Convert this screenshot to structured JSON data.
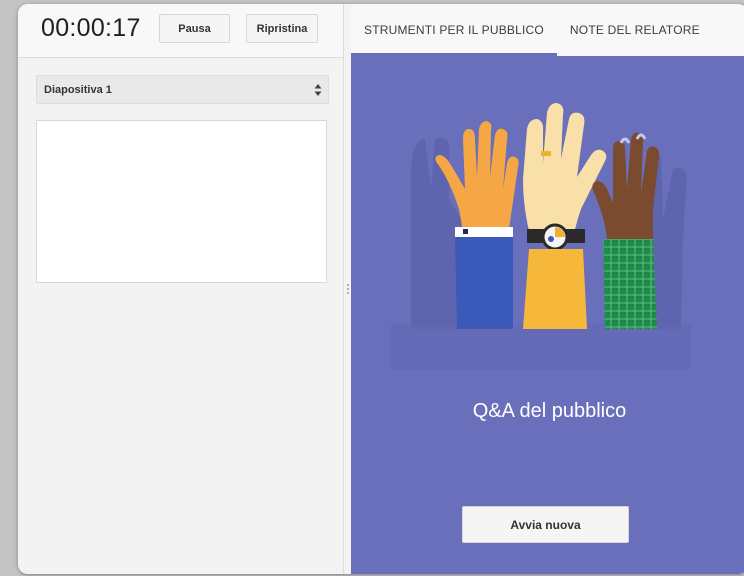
{
  "timer": {
    "value": "00:00:17"
  },
  "controls": {
    "pause_label": "Pausa",
    "reset_label": "Ripristina"
  },
  "slide_selector": {
    "selected": "Diapositiva 1"
  },
  "tabs": [
    {
      "label": "STRUMENTI PER IL PUBBLICO",
      "active": true
    },
    {
      "label": "NOTE DEL RELATORE",
      "active": false
    }
  ],
  "audience_qa": {
    "title": "Q&A del pubblico",
    "start_label": "Avvia nuova"
  },
  "colors": {
    "accent": "#6a6fbb",
    "panel": "#f3f3f3",
    "background": "#c4c4c4"
  }
}
